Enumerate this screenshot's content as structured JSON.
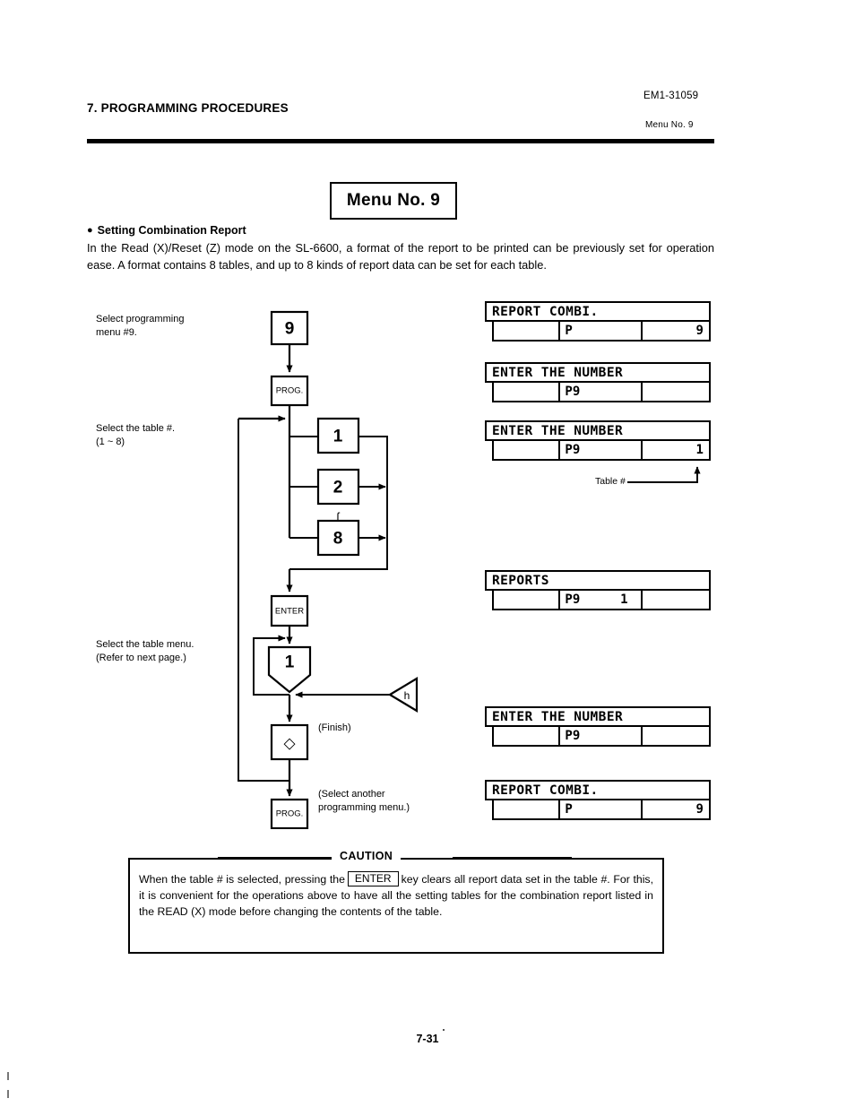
{
  "header": {
    "chapter_title": "7. PROGRAMMING PROCEDURES",
    "doc_code": "EM1-31059",
    "menu_ref": "Menu No. 9"
  },
  "menu_title": "Menu No. 9",
  "section": {
    "heading": "Setting Combination Report",
    "bullet_glyph": "●",
    "body": "In the Read (X)/Reset (Z) mode on the SL-6600, a format of the report to be printed can be previously set for operation ease.  A format contains 8 tables, and up to 8 kinds of report data can be set for each table."
  },
  "side_labels": {
    "select_menu": "Select programming\nmenu #9.",
    "select_table": "Select the table #.\n(1 ~ 8)",
    "select_table_menu": "Select the table menu.\n(Refer to next page.)"
  },
  "flowchart": {
    "node_9": "9",
    "node_prog_top": "PROG.",
    "branch_1": "1",
    "branch_2": "2",
    "branch_tilde": "ʃ",
    "branch_8": "8",
    "node_enter": "ENTER",
    "node_pentagon": "1",
    "node_triangle": "h",
    "node_finish_glyph": "◇",
    "node_prog_bottom": "PROG.",
    "note_finish": "(Finish)",
    "note_another": "(Select another\nprogramming menu.)"
  },
  "displays": [
    {
      "name": "report-combi-initial",
      "title": "REPORT COMBI.",
      "cell1": "",
      "cell2_left": "P",
      "cell2_right": "",
      "cell3": "9"
    },
    {
      "name": "enter-number-blank",
      "title": "ENTER THE NUMBER",
      "cell1": "",
      "cell2_left": "P9",
      "cell2_right": "",
      "cell3": ""
    },
    {
      "name": "enter-number-table",
      "title": "ENTER THE NUMBER",
      "cell1": "",
      "cell2_left": "P9",
      "cell2_right": "",
      "cell3": "1"
    },
    {
      "name": "reports",
      "title": "REPORTS",
      "cell1": "",
      "cell2_left": "P9",
      "cell2_right": "1",
      "cell3": ""
    },
    {
      "name": "enter-number-final",
      "title": "ENTER THE NUMBER",
      "cell1": "",
      "cell2_left": "P9",
      "cell2_right": "",
      "cell3": ""
    },
    {
      "name": "report-combi-final",
      "title": "REPORT COMBI.",
      "cell1": "",
      "cell2_left": "P",
      "cell2_right": "",
      "cell3": "9"
    }
  ],
  "table_callout": "Table #",
  "caution": {
    "legend": "CAUTION",
    "text_before": "When the table # is selected, pressing the",
    "key_label": "ENTER",
    "text_after": "key clears all report data set in the table #.  For this, it is convenient for the operations above to have all the setting tables for the combination report listed in the READ (X) mode before changing the contents of the table."
  },
  "footer": {
    "page_number": "7-31"
  }
}
